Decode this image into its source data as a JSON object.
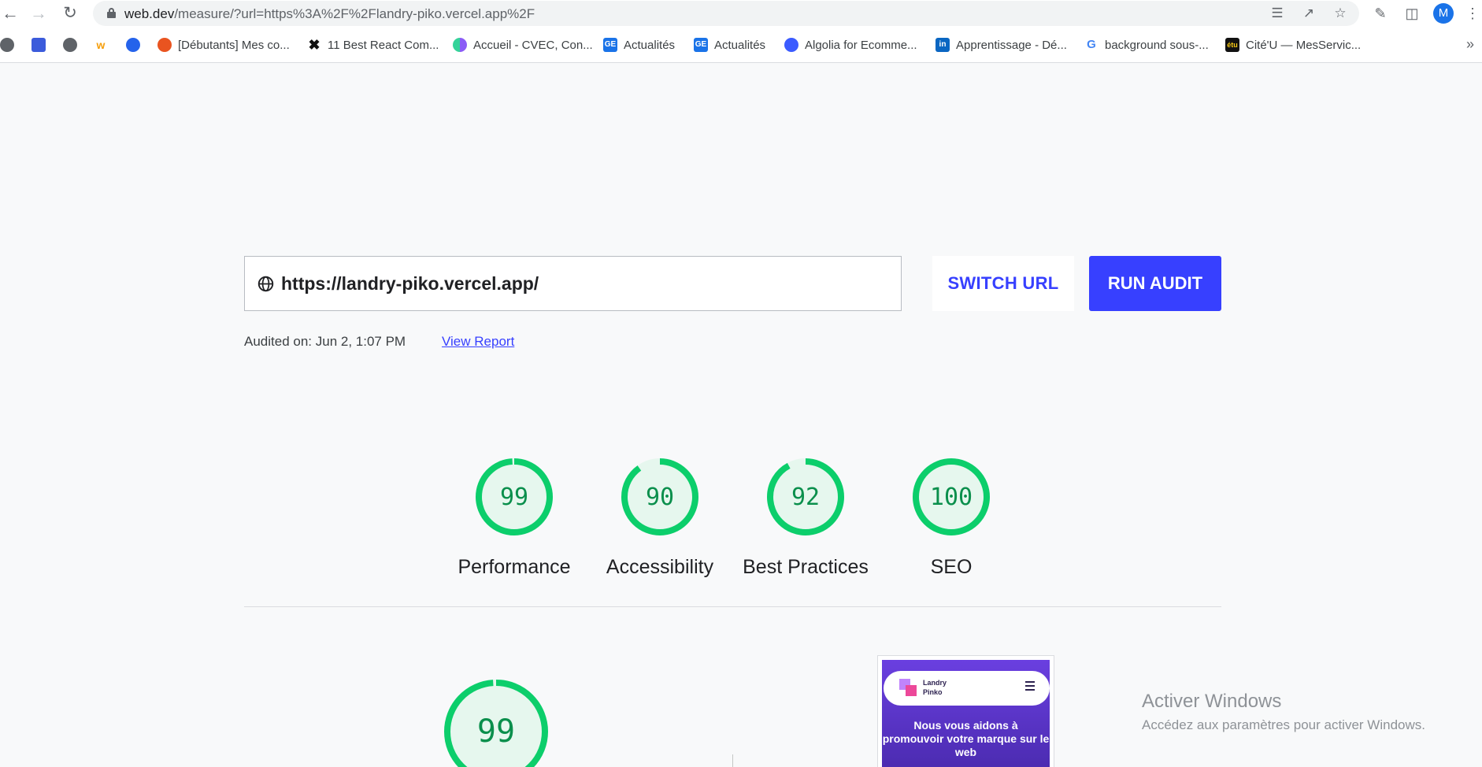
{
  "browser": {
    "url_host": "web.dev",
    "url_path": "/measure/?url=https%3A%2F%2Flandry-piko.vercel.app%2F",
    "profile_initial": "M"
  },
  "bookmarks": [
    {
      "label": "",
      "icon": "globe-icon",
      "color": "#5f6368"
    },
    {
      "label": "",
      "icon": "home-app-icon",
      "color": "#3b5bdb"
    },
    {
      "label": "",
      "icon": "globe-icon",
      "color": "#5f6368"
    },
    {
      "label": "",
      "icon": "w3schools-icon",
      "color": "#f59e0b"
    },
    {
      "label": "",
      "icon": "bug-icon",
      "color": "#2563eb"
    },
    {
      "label": "[Débutants] Mes co...",
      "icon": "ubuntu-icon",
      "color": "#e95420"
    },
    {
      "label": "11 Best React Com...",
      "icon": "x-icon",
      "color": "#111111"
    },
    {
      "label": "Accueil - CVEC, Con...",
      "icon": "cvec-icon",
      "color": "#6d5bd0"
    },
    {
      "label": "Actualités",
      "icon": "ge-icon",
      "color": "#1a73e8"
    },
    {
      "label": "Actualités",
      "icon": "ge-icon",
      "color": "#1a73e8"
    },
    {
      "label": "Algolia for Ecomme...",
      "icon": "algolia-icon",
      "color": "#3b5bff"
    },
    {
      "label": "Apprentissage - Dé...",
      "icon": "linkedin-icon",
      "color": "#0a66c2"
    },
    {
      "label": "background sous-...",
      "icon": "google-icon",
      "color": "#ffffff"
    },
    {
      "label": "Cité'U — MesServic...",
      "icon": "etu-icon",
      "color": "#111111"
    }
  ],
  "audit": {
    "url_value": "https://landry-piko.vercel.app/",
    "switch_url_label": "SWITCH URL",
    "run_audit_label": "RUN AUDIT",
    "audited_on": "Audited on: Jun 2, 1:07 PM",
    "view_report_label": "View Report"
  },
  "scores": [
    {
      "value": 99,
      "label": "Performance"
    },
    {
      "value": 90,
      "label": "Accessibility"
    },
    {
      "value": 92,
      "label": "Best Practices"
    },
    {
      "value": 100,
      "label": "SEO"
    }
  ],
  "detail_score": {
    "value": 99
  },
  "colors": {
    "pass": "#0cce6b",
    "pass_bg": "#e6f7ee",
    "accent": "#3740ff"
  },
  "preview": {
    "brand_line1": "Landry",
    "brand_line2": "Pinko",
    "hero": "Nous vous aidons à promouvoir votre marque sur le web"
  },
  "watermark": {
    "title": "Activer Windows",
    "subtitle": "Accédez aux paramètres pour activer Windows."
  }
}
